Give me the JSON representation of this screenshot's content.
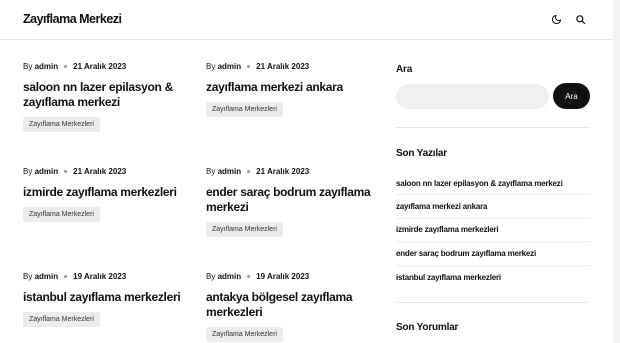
{
  "site": {
    "title": "Zayıflama Merkezi"
  },
  "header": {
    "icons": [
      "moon-icon",
      "search-icon"
    ]
  },
  "posts": [
    {
      "by": "By",
      "author": "admin",
      "date": "21 Aralık 2023",
      "title": "saloon nn lazer epilasyon & zayıflama merkezi",
      "category": "Zayıflama Merkezleri"
    },
    {
      "by": "By",
      "author": "admin",
      "date": "21 Aralık 2023",
      "title": "zayıflama merkezi ankara",
      "category": "Zayıflama Merkezleri"
    },
    {
      "by": "By",
      "author": "admin",
      "date": "21 Aralık 2023",
      "title": "izmirde zayıflama merkezleri",
      "category": "Zayıflama Merkezleri"
    },
    {
      "by": "By",
      "author": "admin",
      "date": "21 Aralık 2023",
      "title": "ender saraç bodrum zayıflama merkezi",
      "category": "Zayıflama Merkezleri"
    },
    {
      "by": "By",
      "author": "admin",
      "date": "19 Aralık 2023",
      "title": "istanbul zayıflama merkezleri",
      "category": "Zayıflama Merkezleri"
    },
    {
      "by": "By",
      "author": "admin",
      "date": "19 Aralık 2023",
      "title": "antakya bölgesel zayıflama merkezleri",
      "category": "Zayıflama Merkezleri"
    }
  ],
  "sidebar": {
    "search": {
      "title": "Ara",
      "placeholder": "",
      "button": "Ara"
    },
    "recent": {
      "title": "Son Yazılar",
      "items": [
        "saloon nn lazer epilasyon & zayıflama merkezi",
        "zayıflama merkezi ankara",
        "izmirde zayıflama merkezleri",
        "ender saraç bodrum zayıflama merkezi",
        "istanbul zayıflama merkezleri"
      ]
    },
    "comments": {
      "title": "Son Yorumlar"
    }
  }
}
